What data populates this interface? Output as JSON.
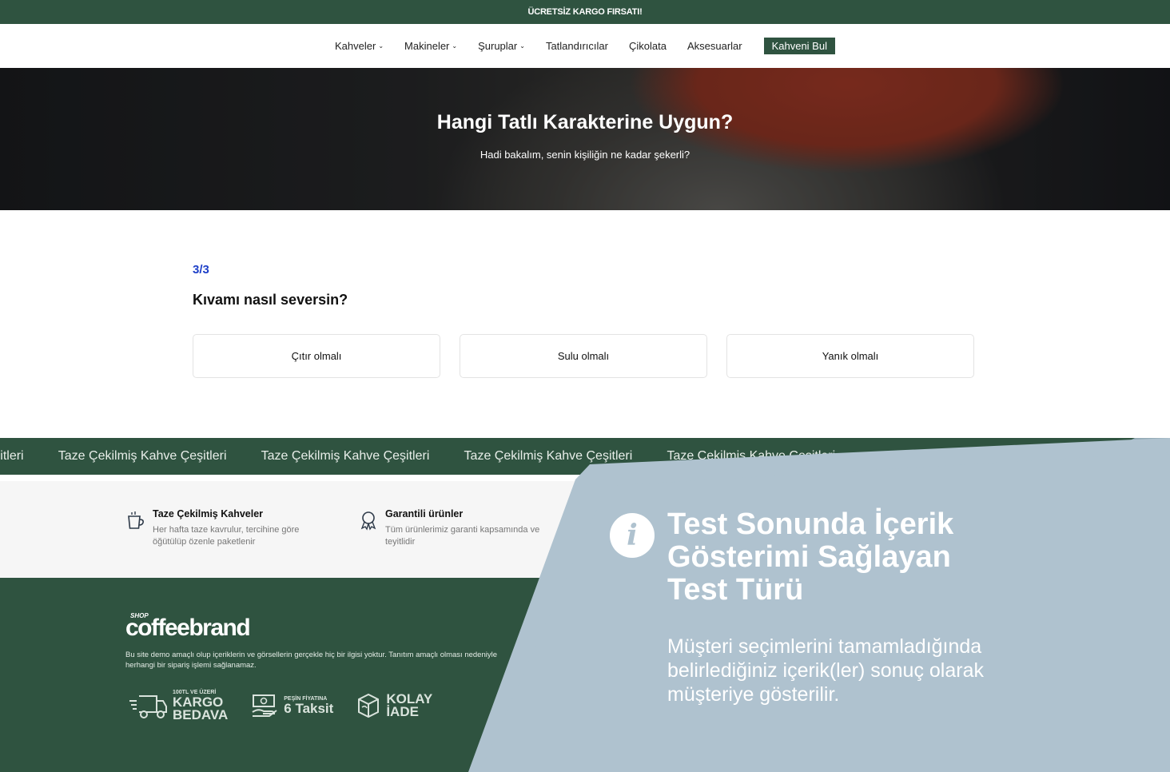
{
  "topbar": {
    "text": "ÜCRETSİZ KARGO FIRSATI!"
  },
  "nav": {
    "items": [
      {
        "label": "Kahveler"
      },
      {
        "label": "Makineler"
      },
      {
        "label": "Şuruplar"
      },
      {
        "label": "Tatlandırıcılar"
      },
      {
        "label": "Çikolata"
      },
      {
        "label": "Aksesuarlar"
      }
    ],
    "cta": "Kahveni Bul"
  },
  "hero": {
    "title": "Hangi Tatlı Karakterine Uygun?",
    "subtitle": "Hadi bakalım, senin kişiliğin ne kadar şekerli?"
  },
  "quiz": {
    "step": "3/3",
    "question": "Kıvamı nasıl seversin?",
    "options": [
      "Çıtır olmalı",
      "Sulu olmalı",
      "Yanık olmalı"
    ]
  },
  "marquee": {
    "items": [
      "Kahve Çeşitleri",
      "Taze Çekilmiş Kahve Çeşitleri",
      "Taze Çekilmiş Kahve Çeşitleri",
      "Taze Çekilmiş Kahve Çeşitleri",
      "Taze Çekilmiş Kahve Çeşitleri"
    ]
  },
  "features": [
    {
      "icon": "coffee-cup-icon",
      "title": "Taze Çekilmiş Kahveler",
      "desc": "Her hafta taze kavrulur, tercihine göre öğütülüp özenle paketlenir"
    },
    {
      "icon": "award-ribbon-icon",
      "title": "Garantili ürünler",
      "desc": "Tüm ürünlerimiz garanti kapsamında ve teyitlidir"
    }
  ],
  "footer": {
    "logo_small": "SHOP",
    "logo_brand": "coffeebrand",
    "disclaimer": "Bu site demo amaçlı olup içeriklerin ve görsellerin gerçekle hiç bir ilgisi yoktur. Tanıtım amaçlı olması nedeniyle herhangi bir sipariş işlemi sağlanamaz.",
    "badges": [
      {
        "icon": "truck-icon",
        "small": "100TL VE ÜZERİ",
        "big1": "KARGO",
        "big2": "BEDAVA"
      },
      {
        "icon": "cash-hand-icon",
        "small": "PEŞİN FİYATINA",
        "big1": "6 Taksit",
        "big2": ""
      },
      {
        "icon": "box-return-icon",
        "small": "",
        "big1": "KOLAY",
        "big2": "İADE"
      }
    ]
  },
  "overlay": {
    "title": "Test Sonunda İçerik Gösterimi Sağlayan Test Türü",
    "text": "Müşteri seçimlerini tamamladığında belirlediğiniz içerik(ler) sonuç olarak müşteriye gösterilir."
  },
  "colors": {
    "brand_green": "#2f5340",
    "accent_blue": "#1e40c8",
    "overlay_blue": "#afc2cf"
  }
}
